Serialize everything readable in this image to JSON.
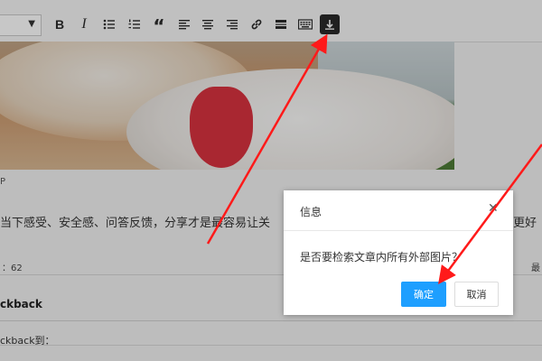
{
  "toolbar": {
    "format_select": {
      "value": ""
    },
    "buttons": [
      {
        "name": "bold",
        "label": "B"
      },
      {
        "name": "italic",
        "label": "I"
      },
      {
        "name": "bullet-list",
        "icon": "bullet-list-icon"
      },
      {
        "name": "numbered-list",
        "icon": "numbered-list-icon"
      },
      {
        "name": "blockquote",
        "label": "“"
      },
      {
        "name": "align-left",
        "icon": "align-left-icon"
      },
      {
        "name": "align-center",
        "icon": "align-center-icon"
      },
      {
        "name": "align-right",
        "icon": "align-right-icon"
      },
      {
        "name": "link",
        "icon": "link-icon"
      },
      {
        "name": "horizontal-rule",
        "icon": "horizontal-rule-icon"
      },
      {
        "name": "keyboard",
        "icon": "keyboard-icon"
      },
      {
        "name": "download-images",
        "icon": "download-icon",
        "active": true
      }
    ]
  },
  "editor": {
    "paragraph_mark": "P",
    "body_text": "当下感受、安全感、问答反馈，分享才是最容易让关",
    "body_text_right": "更好",
    "status_left": "：62",
    "status_right": "最"
  },
  "trackback": {
    "title": "ckback",
    "label": "ckback到："
  },
  "dialog": {
    "title": "信息",
    "message": "是否要检索文章内所有外部图片？",
    "ok_label": "确定",
    "cancel_label": "取消"
  },
  "colors": {
    "accent": "#1e9fff",
    "annotation_arrow": "#ff1a1a"
  }
}
